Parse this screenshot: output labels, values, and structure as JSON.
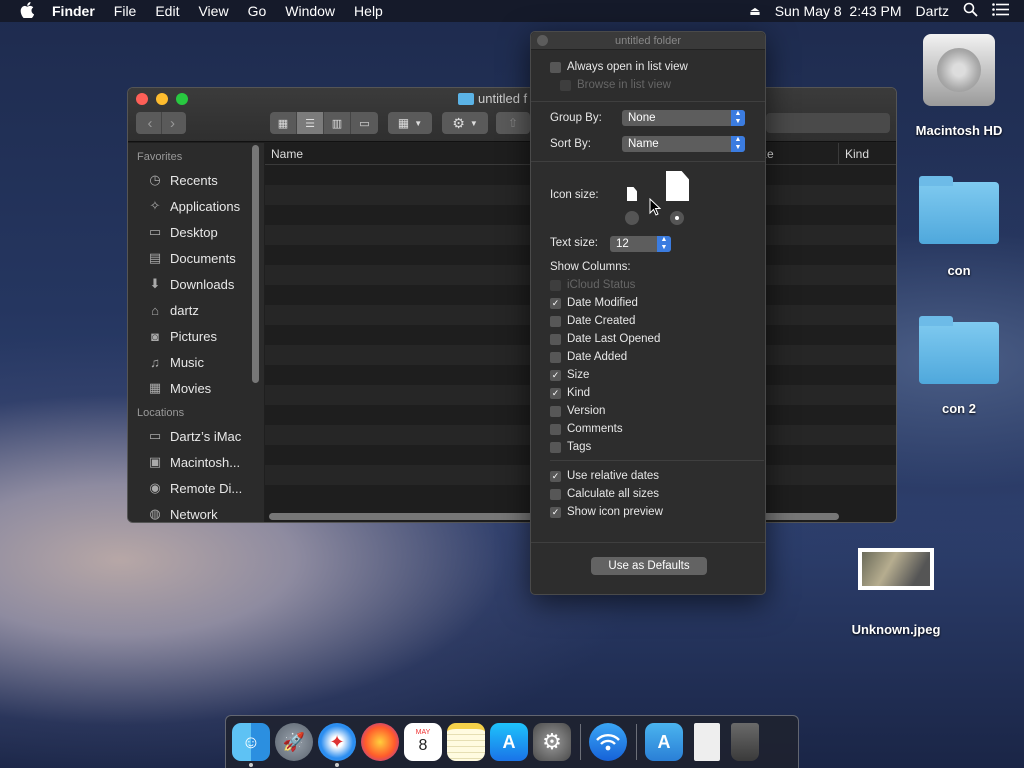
{
  "menubar": {
    "apple": "",
    "app": "Finder",
    "items": [
      "File",
      "Edit",
      "View",
      "Go",
      "Window",
      "Help"
    ],
    "datetime": "Sun May 8  2:43 PM",
    "user": "Dartz"
  },
  "finder": {
    "title": "untitled f",
    "columns": {
      "name": "Name",
      "size": "ze",
      "kind": "Kind"
    },
    "favorites_header": "Favorites",
    "favorites": [
      {
        "label": "Recents",
        "icon": "clock-icon"
      },
      {
        "label": "Applications",
        "icon": "applications-icon"
      },
      {
        "label": "Desktop",
        "icon": "desktop-icon"
      },
      {
        "label": "Documents",
        "icon": "document-icon"
      },
      {
        "label": "Downloads",
        "icon": "download-icon"
      },
      {
        "label": "dartz",
        "icon": "home-icon"
      },
      {
        "label": "Pictures",
        "icon": "camera-icon"
      },
      {
        "label": "Music",
        "icon": "music-icon"
      },
      {
        "label": "Movies",
        "icon": "film-icon"
      }
    ],
    "locations_header": "Locations",
    "locations": [
      {
        "label": "Dartz’s iMac",
        "icon": "computer-icon"
      },
      {
        "label": "Macintosh...",
        "icon": "disk-icon"
      },
      {
        "label": "Remote Di...",
        "icon": "disc-icon"
      },
      {
        "label": "Network",
        "icon": "network-icon"
      }
    ]
  },
  "view_options": {
    "title": "untitled folder",
    "always_list": "Always open in list view",
    "browse_list": "Browse in list view",
    "group_by_label": "Group By:",
    "group_by_value": "None",
    "sort_by_label": "Sort By:",
    "sort_by_value": "Name",
    "icon_size_label": "Icon size:",
    "text_size_label": "Text size:",
    "text_size_value": "12",
    "show_columns_label": "Show Columns:",
    "columns": [
      {
        "label": "iCloud Status",
        "checked": false,
        "disabled": true
      },
      {
        "label": "Date Modified",
        "checked": true,
        "disabled": false
      },
      {
        "label": "Date Created",
        "checked": false,
        "disabled": false
      },
      {
        "label": "Date Last Opened",
        "checked": false,
        "disabled": false
      },
      {
        "label": "Date Added",
        "checked": false,
        "disabled": false
      },
      {
        "label": "Size",
        "checked": true,
        "disabled": false
      },
      {
        "label": "Kind",
        "checked": true,
        "disabled": false
      },
      {
        "label": "Version",
        "checked": false,
        "disabled": false
      },
      {
        "label": "Comments",
        "checked": false,
        "disabled": false
      },
      {
        "label": "Tags",
        "checked": false,
        "disabled": false
      }
    ],
    "options": [
      {
        "label": "Use relative dates",
        "checked": true
      },
      {
        "label": "Calculate all sizes",
        "checked": false
      },
      {
        "label": "Show icon preview",
        "checked": true
      }
    ],
    "defaults_button": "Use as Defaults"
  },
  "desktop": {
    "items": [
      {
        "label": "Macintosh HD",
        "icon": "hard-drive-icon"
      },
      {
        "label": "con",
        "icon": "folder-icon"
      },
      {
        "label": "con 2",
        "icon": "folder-icon"
      },
      {
        "label": "Unknown.jpeg",
        "icon": "image-thumbnail-icon"
      }
    ]
  },
  "dock": {
    "calendar_month": "MAY",
    "calendar_day": "8"
  }
}
